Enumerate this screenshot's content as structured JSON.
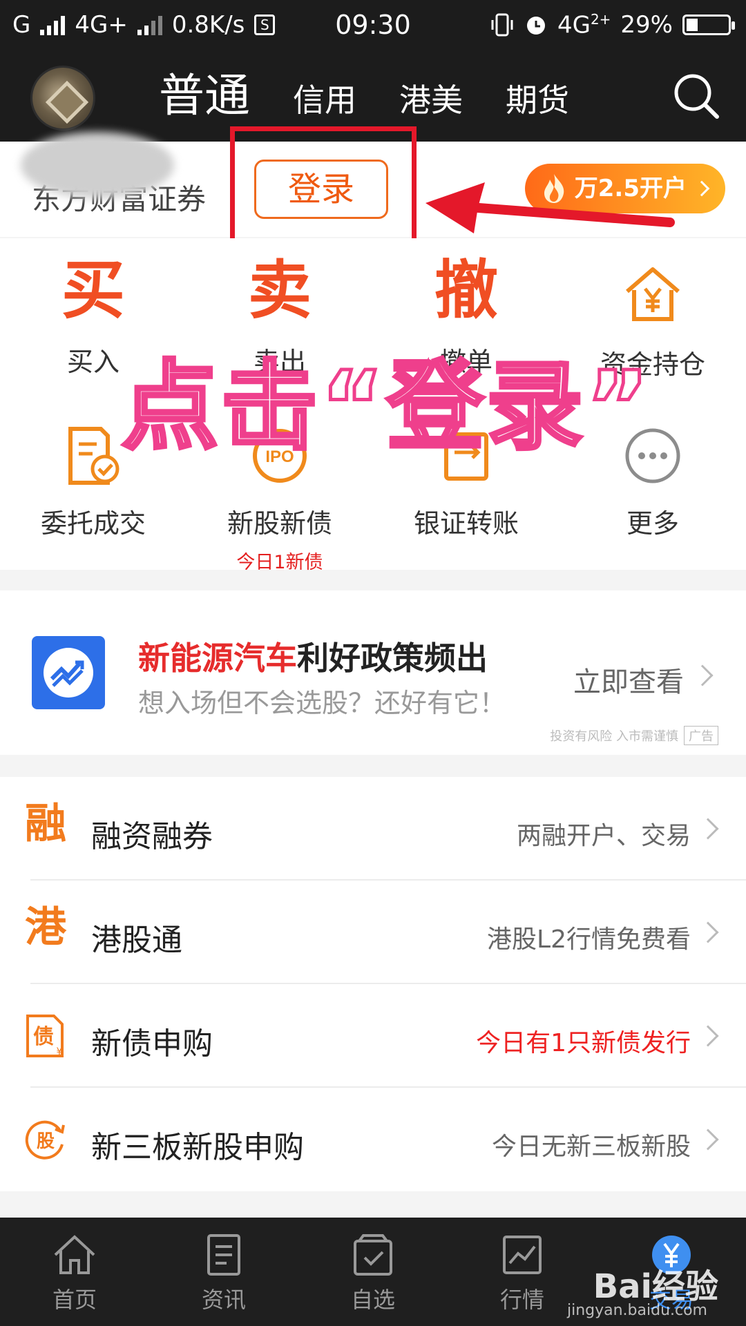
{
  "status_bar": {
    "carrier1": "G",
    "network1": "4G+",
    "speed": "0.8K/s",
    "s_badge": "S",
    "time": "09:30",
    "network2": "4G",
    "network2_sup": "2+",
    "battery": "29%"
  },
  "header": {
    "tabs": [
      "普通",
      "信用",
      "港美",
      "期货"
    ],
    "active_tab": "普通"
  },
  "login_row": {
    "broker_name": "东方财富证券",
    "login_label": "登录",
    "open_account_label": "万2.5开户"
  },
  "grid": {
    "items": [
      {
        "glyph": "买",
        "label": "买入",
        "icon": "buy-glyph"
      },
      {
        "glyph": "卖",
        "label": "卖出",
        "icon": "sell-glyph"
      },
      {
        "glyph": "撤",
        "label": "撤单",
        "icon": "cancel-glyph"
      },
      {
        "glyph": "",
        "label": "资金持仓",
        "icon": "house-yuan-icon"
      },
      {
        "glyph": "",
        "label": "委托成交",
        "icon": "document-check-icon"
      },
      {
        "glyph": "",
        "label": "新股新债",
        "sub": "今日1新债",
        "icon": "ipo-icon"
      },
      {
        "glyph": "",
        "label": "银证转账",
        "icon": "bank-transfer-icon"
      },
      {
        "glyph": "",
        "label": "更多",
        "icon": "more-icon"
      }
    ]
  },
  "overlay": {
    "instruction": "点击“登录”"
  },
  "ad": {
    "title_highlight": "新能源汽车",
    "title_rest": "利好政策频出",
    "subtitle": "想入场但不会选股？还好有它！",
    "link_label": "立即查看",
    "risk_note": "投资有风险 入市需谨慎",
    "ad_tag": "广告"
  },
  "list": [
    {
      "glyph": "融",
      "title": "融资融券",
      "right": "两融开户、交易",
      "highlight": false
    },
    {
      "glyph": "港",
      "title": "港股通",
      "right": "港股L2行情免费看",
      "highlight": false
    },
    {
      "glyph": "",
      "title": "新债申购",
      "right": "今日有1只新债发行",
      "highlight": true
    },
    {
      "glyph": "",
      "title": "新三板新股申购",
      "right": "今日无新三板新股",
      "highlight": false
    }
  ],
  "bottom_nav": {
    "items": [
      "首页",
      "资讯",
      "自选",
      "行情",
      "交易"
    ],
    "active": "交易"
  },
  "watermark": {
    "brand": "Bai经验",
    "url": "jingyan.baidu.com"
  },
  "colors": {
    "accent_orange": "#ef5a10",
    "annotation_red": "#e4182a",
    "overlay_pink": "#ef3f8c",
    "nav_active_blue": "#3f8ff0"
  }
}
